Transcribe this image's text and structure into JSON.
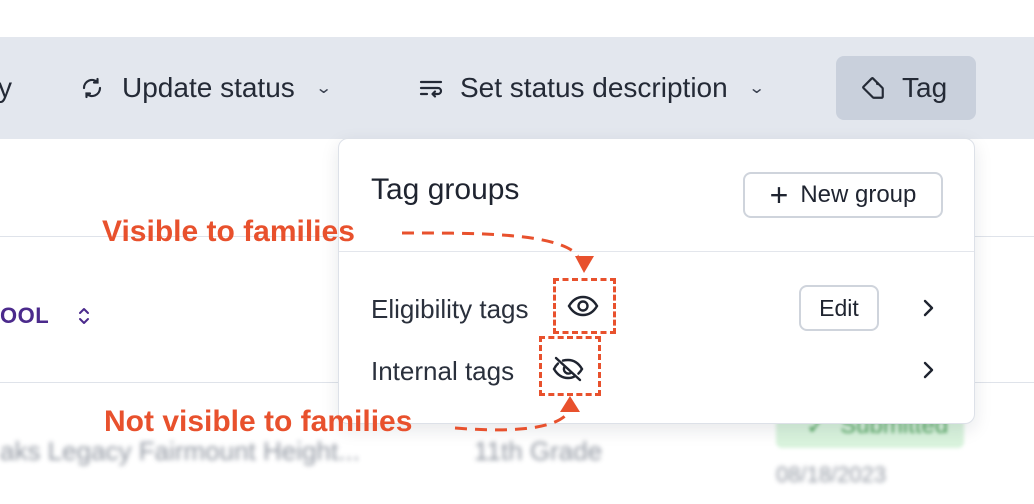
{
  "toolbar": {
    "partial_label": "y",
    "update_status_label": "Update status",
    "set_status_description_label": "Set status description",
    "tag_label": "Tag"
  },
  "background": {
    "school_label": "OOL",
    "row_school_name": "aks Legacy Fairmount Height...",
    "row_grade": "11th Grade",
    "status_label": "Submitted",
    "row_date": "08/18/2023"
  },
  "tag_panel": {
    "title": "Tag groups",
    "new_group_label": "New group",
    "groups": [
      {
        "label": "Eligibility tags",
        "visibility": "visible-to-families",
        "edit_label": "Edit"
      },
      {
        "label": "Internal tags",
        "visibility": "hidden-from-families"
      }
    ]
  },
  "annotations": {
    "visible": "Visible to families",
    "not_visible": "Not visible to families",
    "color": "#e8512d"
  },
  "colors": {
    "toolbar_bg": "#e3e7ee",
    "tag_button_bg": "#c9d0dc",
    "school_text": "#4b2a8c",
    "status_green_bg": "#d9f3dd"
  }
}
